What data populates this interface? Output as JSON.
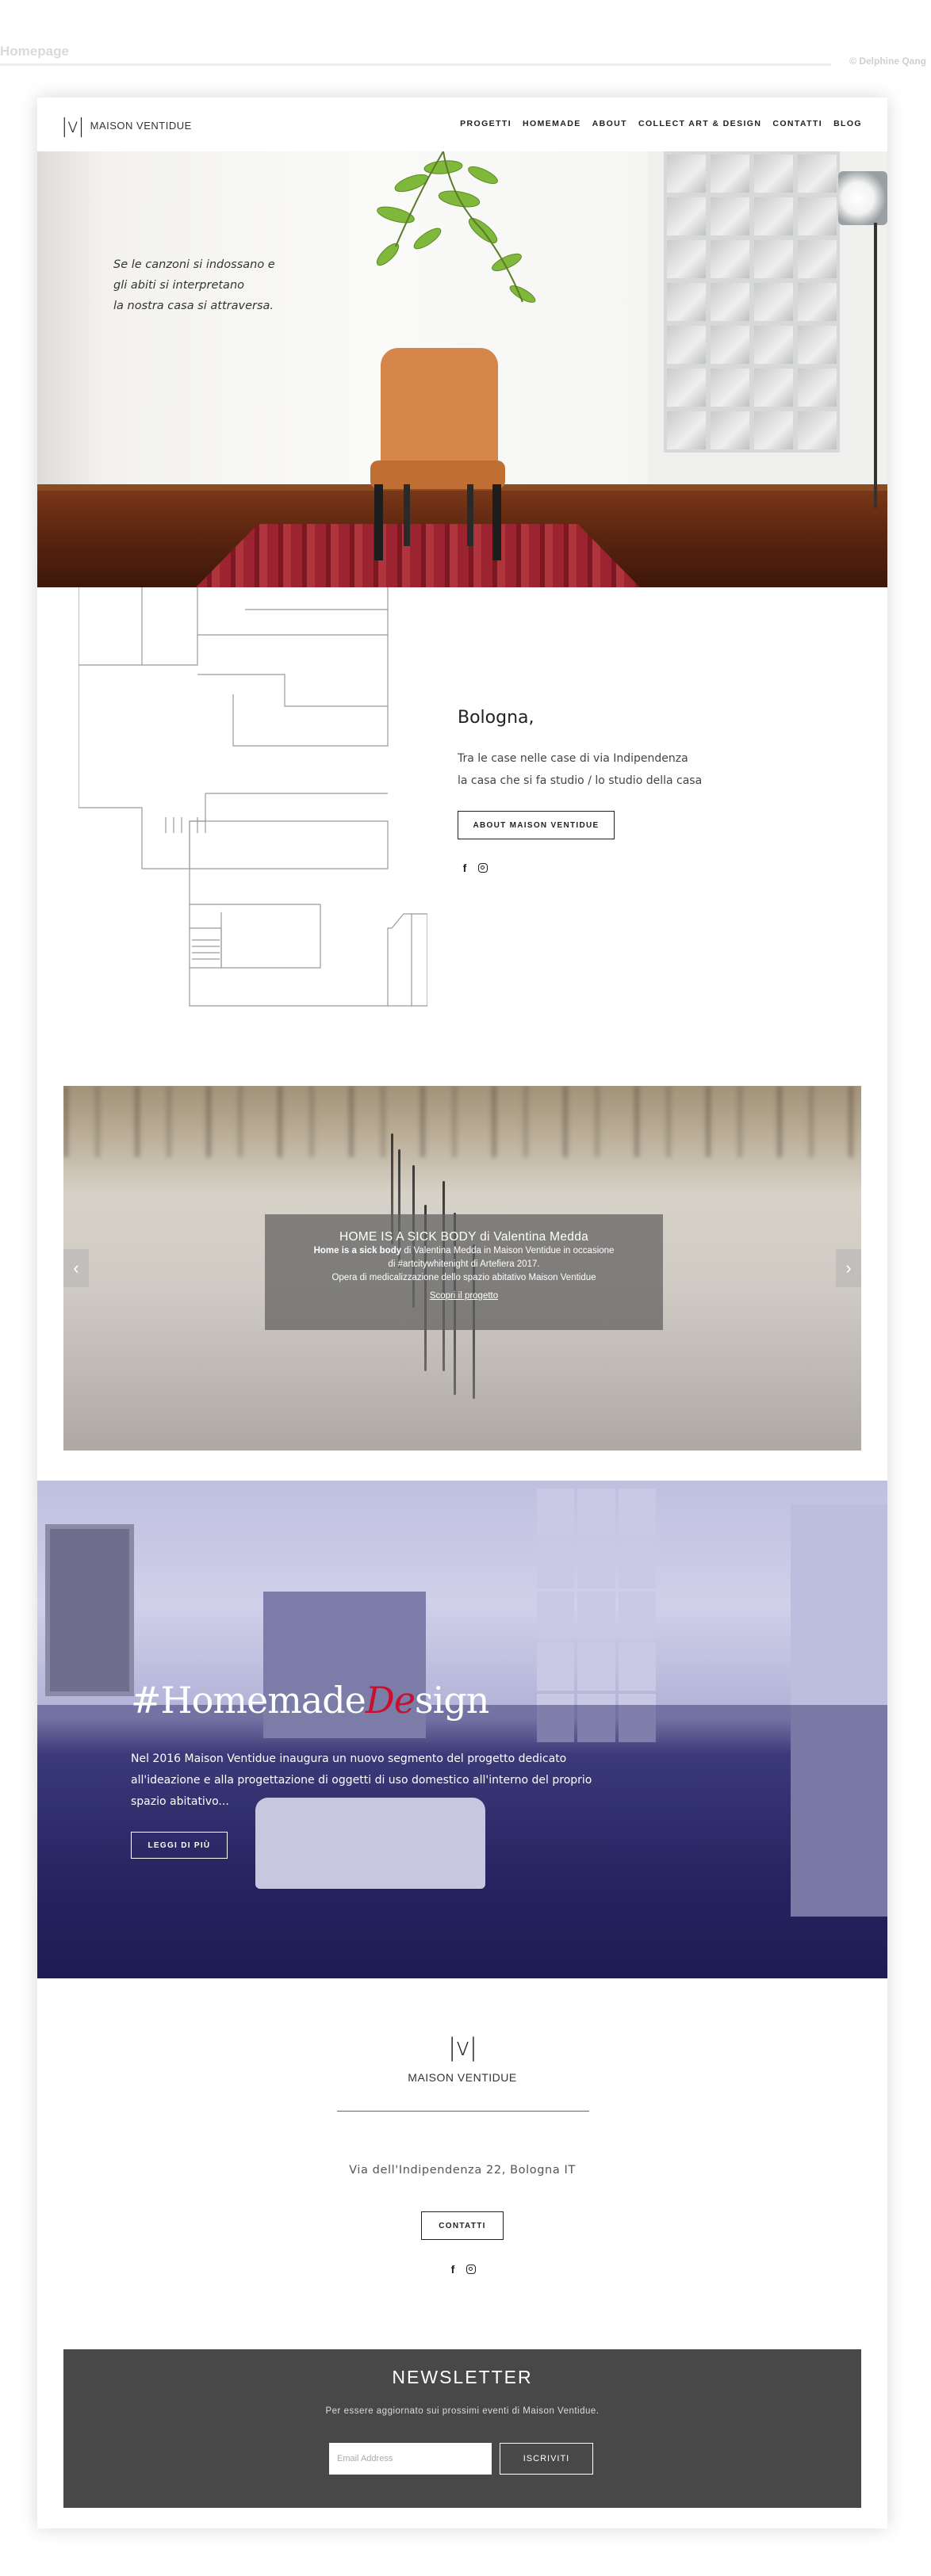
{
  "presentation": {
    "title": "Homepage",
    "credit": "© Delphine Qang"
  },
  "nav": {
    "logo_mark": "|v|",
    "logo_text": "MAISON VENTIDUE",
    "items": [
      "PROGETTI",
      "HOMEMADE",
      "ABOUT",
      "COLLECT ART & DESIGN",
      "CONTATTI",
      "BLOG"
    ]
  },
  "hero": {
    "quote": [
      "Se le canzoni si indossano e",
      "gli abiti si interpretano",
      "la nostra casa si attraversa."
    ]
  },
  "about": {
    "city": "Bologna,",
    "lines": [
      "Tra le case nelle case di via Indipendenza",
      "la casa che si fa studio / lo studio della casa"
    ],
    "button": "ABOUT MAISON VENTIDUE",
    "social": {
      "facebook_icon": "f",
      "instagram_icon": "instagram-icon"
    }
  },
  "slider": {
    "title": "HOME IS A SICK BODY di Valentina Medda",
    "lead_bold": "Home is a sick body",
    "line1_rest": " di Valentina Medda in Maison Ventidue in occasione",
    "line2": "di #artcitywhitenight di Artefiera 2017.",
    "line3": "Opera di medicalizzazione dello spazio abitativo Maison Ventidue",
    "link": "Scopri il progetto",
    "prev": "‹",
    "next": "›"
  },
  "homemade": {
    "title_a": "#Homemade",
    "title_b": "De",
    "title_c": "sign",
    "accent_color": "#c8102e",
    "text": [
      "Nel 2016 Maison Ventidue inaugura un nuovo segmento del progetto dedicato",
      "all'ideazione e alla progettazione di oggetti di uso domestico all'interno del proprio",
      "spazio abitativo..."
    ],
    "button": "LEGGI DI PIÙ"
  },
  "footer": {
    "logo_mark": "|v|",
    "brand": "MAISON VENTIDUE",
    "address": "Via dell'Indipendenza 22, Bologna IT",
    "button": "CONTATTI",
    "social": {
      "facebook_icon": "f",
      "instagram_icon": "instagram-icon"
    }
  },
  "newsletter": {
    "title": "NEWSLETTER",
    "subtitle": "Per essere aggiornato sui prossimi eventi di Maison Ventidue.",
    "placeholder": "Email Address",
    "button": "ISCRIVITI",
    "bg_color": "#484848"
  }
}
